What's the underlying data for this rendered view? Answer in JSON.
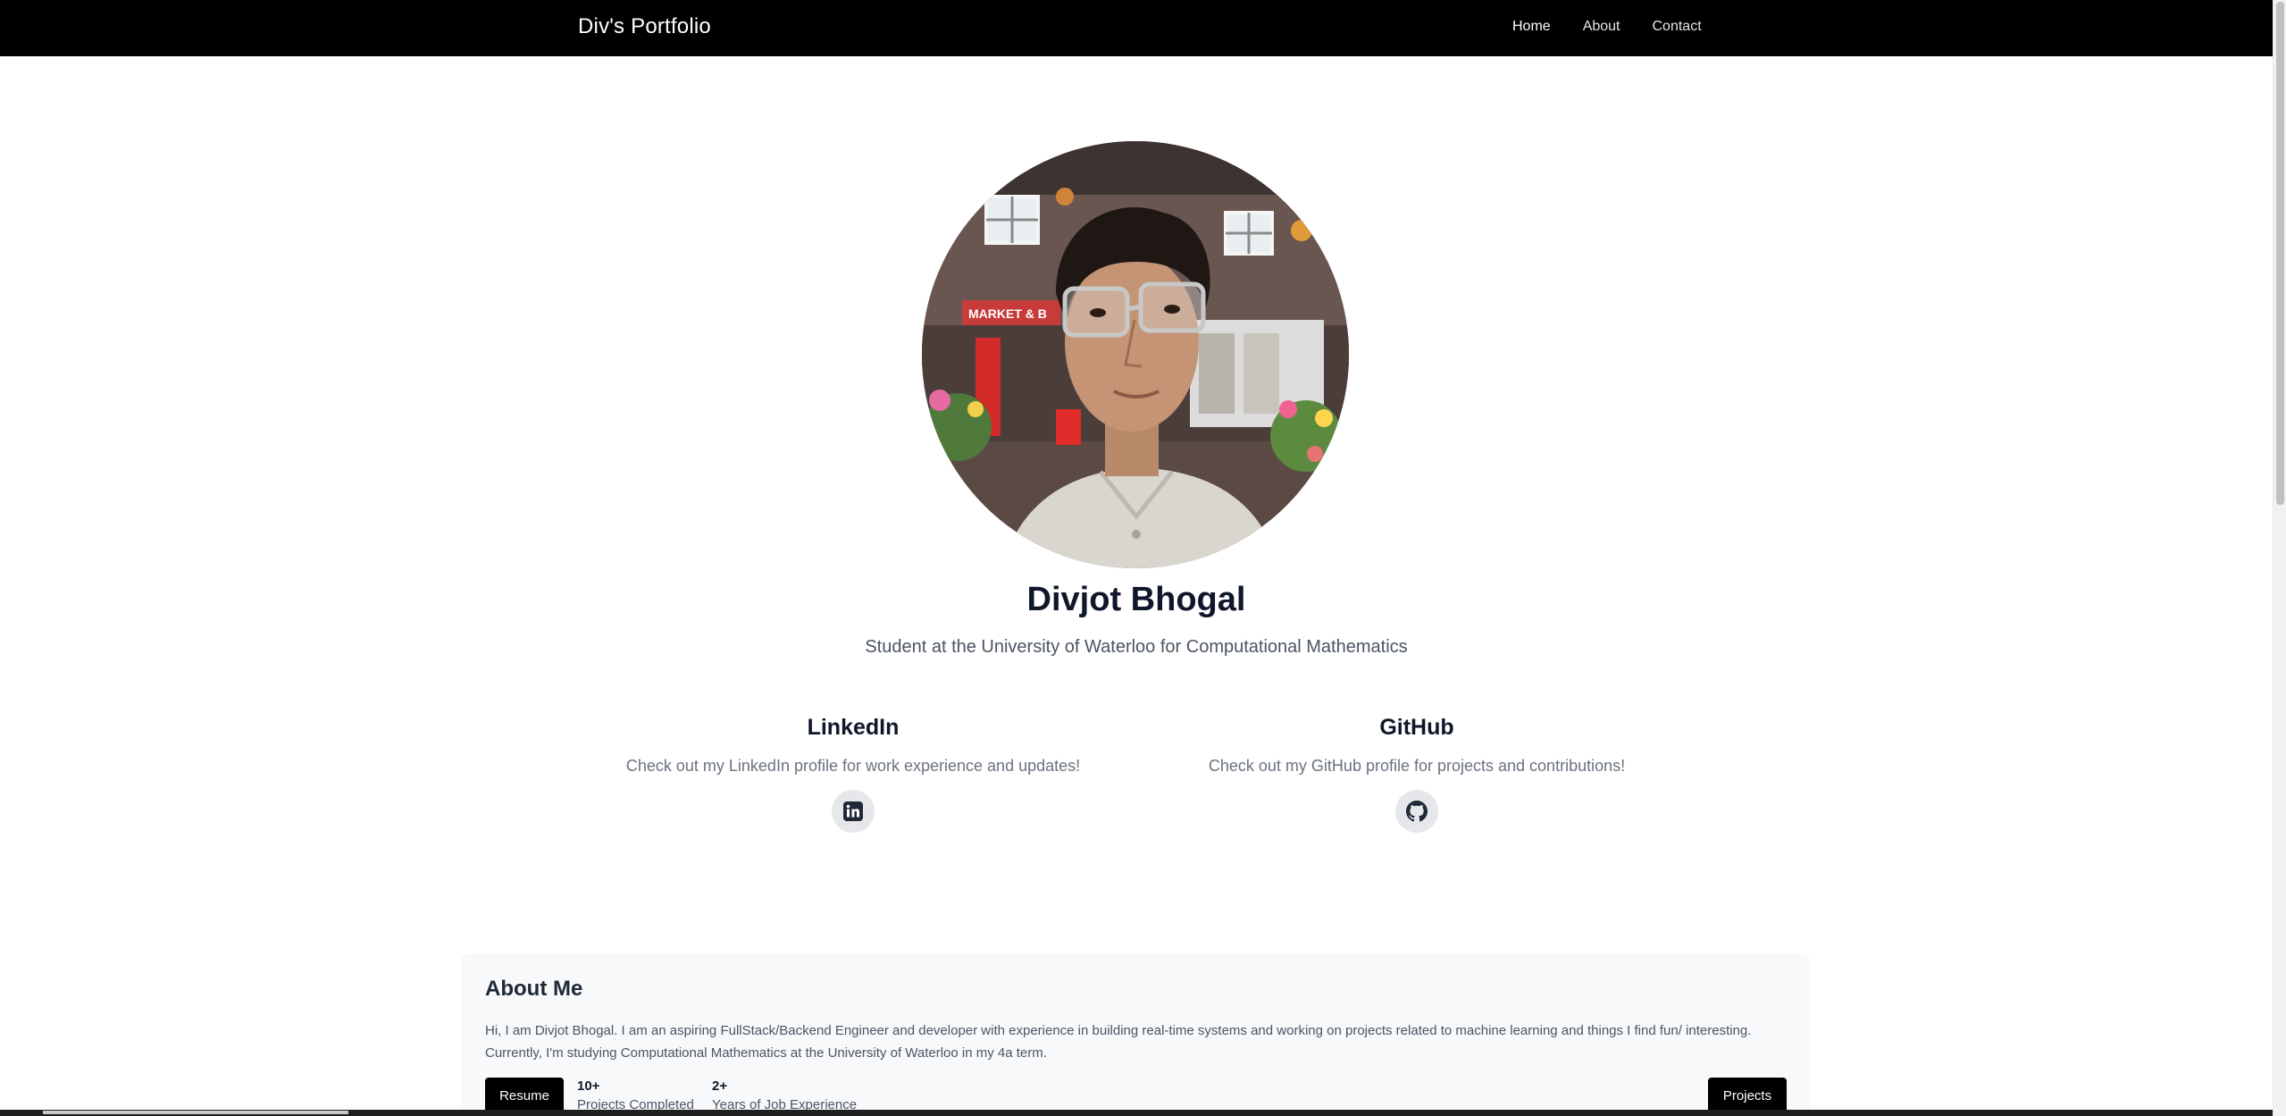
{
  "nav": {
    "brand": "Div's Portfolio",
    "links": [
      {
        "label": "Home",
        "active": true
      },
      {
        "label": "About",
        "active": false
      },
      {
        "label": "Contact",
        "active": false
      }
    ]
  },
  "hero": {
    "name": "Divjot Bhogal",
    "subtitle": "Student at the University of Waterloo for Computational Mathematics",
    "photo_sign_text": "MARKET & B"
  },
  "social": {
    "linkedin": {
      "title": "LinkedIn",
      "description": "Check out my LinkedIn profile for work experience and updates!",
      "icon": "linkedin-icon"
    },
    "github": {
      "title": "GitHub",
      "description": "Check out my GitHub profile for projects and contributions!",
      "icon": "github-icon"
    }
  },
  "about": {
    "title": "About Me",
    "text": "Hi, I am Divjot Bhogal. I am an aspiring FullStack/Backend Engineer and developer with experience in building real-time systems and working on projects related to machine learning and things I find fun/ interesting. Currently, I'm studying Computational Mathematics at the University of Waterloo in my 4a term.",
    "resume_label": "Resume",
    "projects_label": "Projects",
    "stats": [
      {
        "value": "10+",
        "label": "Projects Completed"
      },
      {
        "value": "2+",
        "label": "Years of Job Experience"
      }
    ]
  },
  "colors": {
    "navbar": "#000000",
    "text_dark": "#0f172a",
    "text_muted": "#4b5563",
    "about_bg": "#f8f9fb"
  }
}
